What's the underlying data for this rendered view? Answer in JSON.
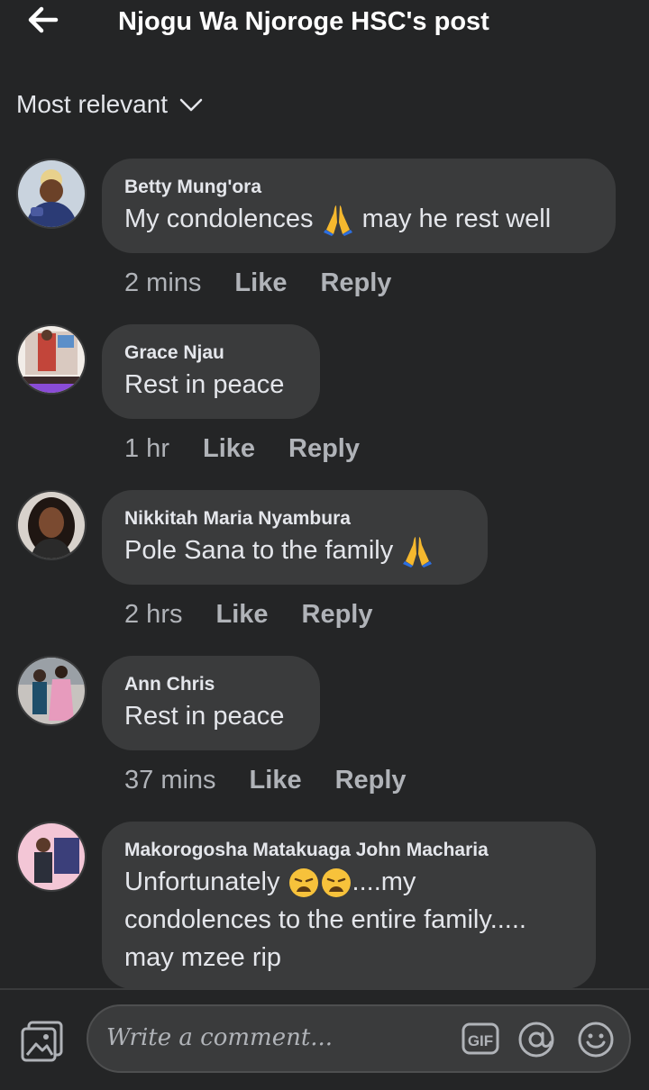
{
  "header": {
    "back_icon": "arrow-left-icon",
    "title": "Njogu Wa Njoroge HSC's post"
  },
  "sort": {
    "label": "Most relevant",
    "icon": "chevron-down-icon"
  },
  "comments": [
    {
      "author": "Betty Mung'ora",
      "text_before": "My condolences ",
      "emoji": "folded-hands-icon",
      "text_after": " may he rest well",
      "time": "2 mins",
      "like": "Like",
      "reply": "Reply"
    },
    {
      "author": "Grace Njau",
      "text": "Rest in peace",
      "time": "1 hr",
      "like": "Like",
      "reply": "Reply"
    },
    {
      "author": "Nikkitah Maria Nyambura",
      "text_before": "Pole Sana to the family ",
      "emoji": "folded-hands-icon",
      "time": "2 hrs",
      "like": "Like",
      "reply": "Reply"
    },
    {
      "author": "Ann Chris",
      "text": "Rest in peace",
      "time": "37 mins",
      "like": "Like",
      "reply": "Reply"
    },
    {
      "author": "Makorogosha Matakuaga John Macharia",
      "line1_before": "Unfortunately ",
      "emoji": "weary-face-icon",
      "line1_after": "....my",
      "line2": "condolences to the entire family.....",
      "line3": "may mzee rip"
    }
  ],
  "composer": {
    "placeholder": "Write a comment...",
    "photo_icon": "photo-icon",
    "gif_label": "GIF",
    "at_icon": "at-sign-icon",
    "emoji_icon": "smiley-icon"
  },
  "colors": {
    "background": "#242526",
    "bubble": "#3a3b3c",
    "text": "#e4e6eb",
    "secondary_text": "#b0b3b8"
  }
}
